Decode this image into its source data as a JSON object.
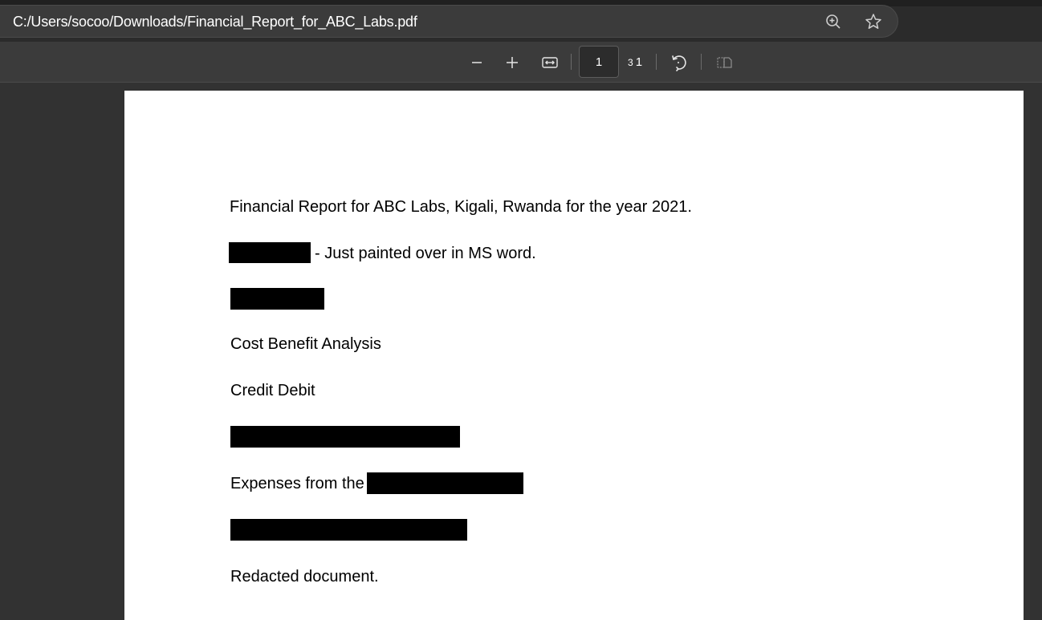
{
  "address_bar": {
    "url": "C:/Users/socoo/Downloads/Financial_Report_for_ABC_Labs.pdf",
    "zoom_icon": "zoom-in-icon",
    "favorite_icon": "star-icon"
  },
  "toolbar": {
    "zoom_out_icon": "minus-icon",
    "zoom_in_icon": "plus-icon",
    "fit_icon": "fit-to-width-icon",
    "current_page": "1",
    "page_total_prefix": "3",
    "page_total": "1",
    "rotate_icon": "rotate-icon",
    "two_page_icon": "two-page-view-icon"
  },
  "document": {
    "line1": "Financial Report for ABC Labs, Kigali, Rwanda for the year 2021.",
    "line2_suffix": "- Just painted over in MS word.",
    "line4": "Cost Benefit Analysis",
    "line5": "Credit Debit",
    "line7_prefix": "Expenses from the",
    "line9": "Redacted document."
  },
  "colors": {
    "app_background": "#323232",
    "toolbar_background": "#3b3b3b",
    "page_background": "#ffffff",
    "redaction": "#000000"
  }
}
